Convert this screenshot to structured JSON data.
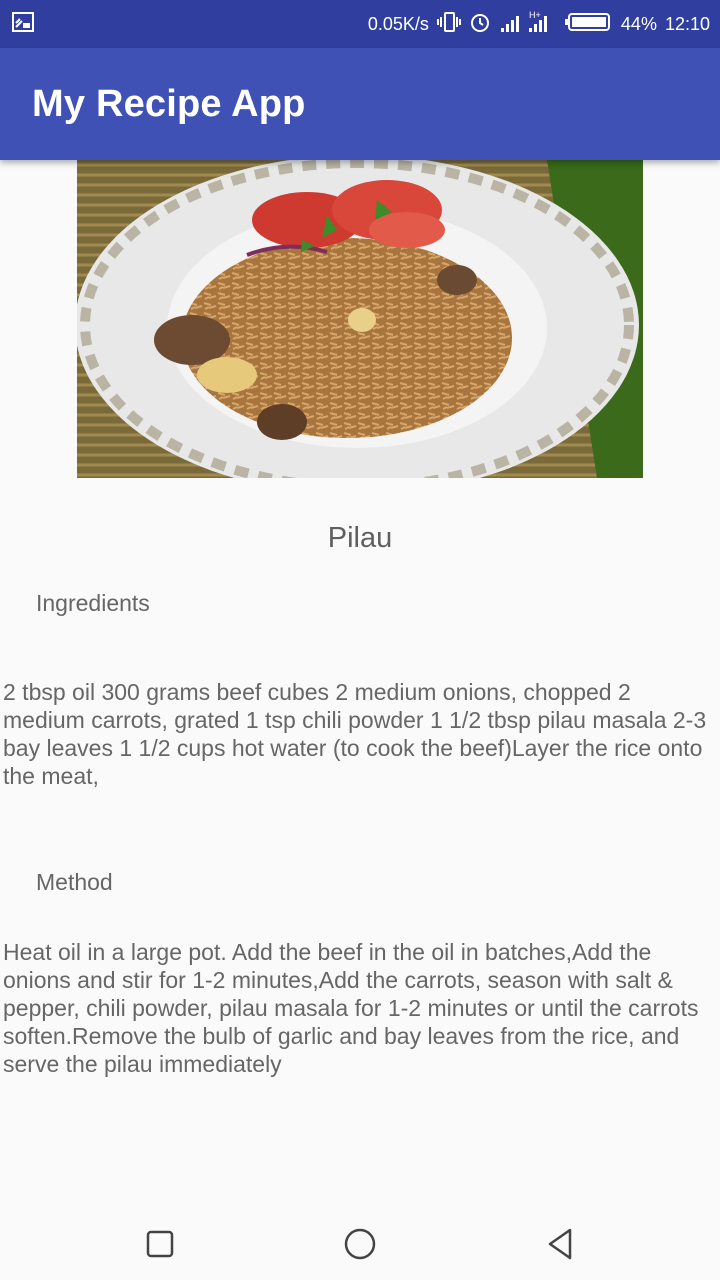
{
  "status_bar": {
    "speed": "0.05K/s",
    "network_type": "H+",
    "battery": "44%",
    "time": "12:10"
  },
  "app_bar": {
    "title": "My Recipe App"
  },
  "recipe": {
    "title": "Pilau",
    "ingredients_label": "Ingredients",
    "ingredients_text": "2 tbsp oil 300 grams beef cubes 2 medium onions, chopped 2 medium carrots, grated 1 tsp chili powder 1 1/2 tbsp pilau masala 2-3 bay leaves 1 1/2 cups hot water (to cook the beef)Layer the rice onto the meat,",
    "method_label": "Method",
    "method_text": "Heat oil in a large pot. Add the beef in the oil in batches,Add the onions and stir for 1-2 minutes,Add the carrots, season with salt & pepper, chili powder, pilau masala for 1-2 minutes or until the carrots soften.Remove the bulb of garlic and bay leaves from the rice, and serve the pilau immediately"
  },
  "colors": {
    "status_bar": "#303f9f",
    "app_bar": "#3f51b5",
    "text": "#666666"
  },
  "icons": [
    "screencast-icon",
    "vibrate-icon",
    "alarm-icon",
    "signal-icon",
    "battery-icon",
    "recents-icon",
    "home-icon",
    "back-icon"
  ]
}
